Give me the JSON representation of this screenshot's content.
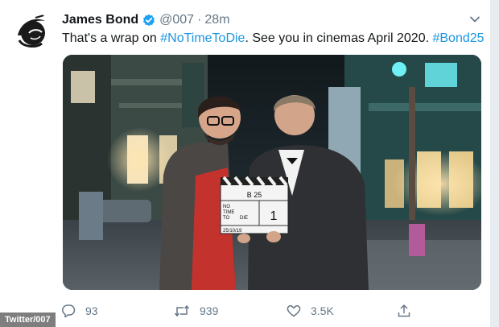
{
  "tweet": {
    "author_name": "James Bond",
    "handle": "@007",
    "separator": "·",
    "time": "28m",
    "text_prefix": "That's a wrap on ",
    "hashtag_1": "#NoTimeToDie",
    "text_middle": ". See you in cinemas April 2020. ",
    "hashtag_2": "#Bond25"
  },
  "media": {
    "slate_top": "B 25",
    "slate_line_1": "NO",
    "slate_line_2": "TIME",
    "slate_line_3": "TO",
    "slate_line_4": "DIE",
    "slate_take": "1",
    "slate_date": "25/10/19"
  },
  "actions": {
    "replies": "93",
    "retweets": "939",
    "likes": "3.5K"
  },
  "watermark": "Twitter/007",
  "colors": {
    "link": "#1b95e0",
    "verified": "#1da1f2",
    "muted": "#657786"
  },
  "icons": [
    "gun-barrel-logo",
    "verified-icon",
    "chevron-down-icon",
    "reply-icon",
    "retweet-icon",
    "like-icon",
    "share-icon"
  ]
}
